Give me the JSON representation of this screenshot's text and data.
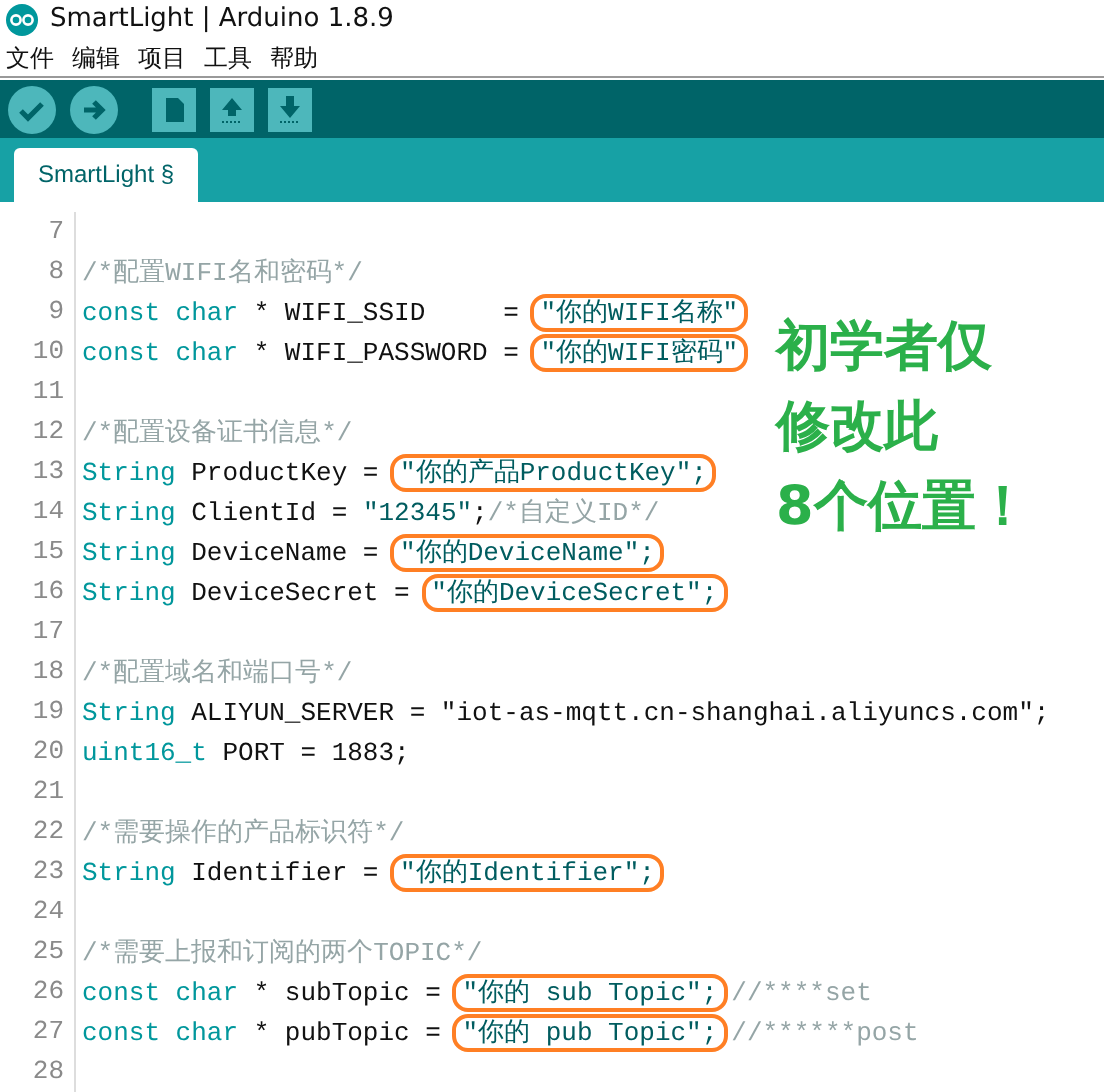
{
  "window": {
    "title": "SmartLight | Arduino 1.8.9"
  },
  "menu": [
    "文件",
    "编辑",
    "项目",
    "工具",
    "帮助"
  ],
  "tabs": [
    {
      "label": "SmartLight §",
      "selected": true
    }
  ],
  "code": [
    {
      "number": "7"
    },
    {
      "number": "8",
      "tokens": [
        {
          "kind": "comment",
          "text": "/*配置WIFI名和密码*/"
        }
      ]
    },
    {
      "number": "9",
      "tokens": [
        {
          "kind": "keyword",
          "text": "const char"
        },
        {
          "kind": "plain",
          "text": " * WIFI_SSID     = "
        },
        {
          "kind": "string",
          "text": "\"你的WIFI名称\"",
          "circled": true
        }
      ]
    },
    {
      "number": "10",
      "tokens": [
        {
          "kind": "keyword",
          "text": "const char"
        },
        {
          "kind": "plain",
          "text": " * WIFI_PASSWORD = "
        },
        {
          "kind": "string",
          "text": "\"你的WIFI密码\"",
          "circled": true
        }
      ]
    },
    {
      "number": "11"
    },
    {
      "number": "12",
      "tokens": [
        {
          "kind": "comment",
          "text": "/*配置设备证书信息*/"
        }
      ]
    },
    {
      "number": "13",
      "tokens": [
        {
          "kind": "keyword",
          "text": "String"
        },
        {
          "kind": "plain",
          "text": " ProductKey = "
        },
        {
          "kind": "string",
          "text": "\"你的产品ProductKey\";",
          "circled": true
        }
      ]
    },
    {
      "number": "14",
      "tokens": [
        {
          "kind": "keyword",
          "text": "String"
        },
        {
          "kind": "plain",
          "text": " ClientId = "
        },
        {
          "kind": "string",
          "text": "\"12345\""
        },
        {
          "kind": "plain",
          "text": ";"
        },
        {
          "kind": "comment",
          "text": "/*自定义ID*/"
        }
      ]
    },
    {
      "number": "15",
      "tokens": [
        {
          "kind": "keyword",
          "text": "String"
        },
        {
          "kind": "plain",
          "text": " DeviceName = "
        },
        {
          "kind": "string",
          "text": "\"你的DeviceName\";",
          "circled": true
        }
      ]
    },
    {
      "number": "16",
      "tokens": [
        {
          "kind": "keyword",
          "text": "String"
        },
        {
          "kind": "plain",
          "text": " DeviceSecret = "
        },
        {
          "kind": "string",
          "text": "\"你的DeviceSecret\";",
          "circled": true
        }
      ]
    },
    {
      "number": "17"
    },
    {
      "number": "18",
      "tokens": [
        {
          "kind": "comment",
          "text": "/*配置域名和端口号*/"
        }
      ]
    },
    {
      "number": "19",
      "tokens": [
        {
          "kind": "keyword",
          "text": "String"
        },
        {
          "kind": "plain",
          "text": " ALIYUN_SERVER = \"iot-as-mqtt.cn-shanghai.aliyuncs.com\";"
        }
      ]
    },
    {
      "number": "20",
      "tokens": [
        {
          "kind": "keyword",
          "text": "uint16_t"
        },
        {
          "kind": "plain",
          "text": " PORT = 1883;"
        }
      ]
    },
    {
      "number": "21"
    },
    {
      "number": "22",
      "tokens": [
        {
          "kind": "comment",
          "text": "/*需要操作的产品标识符*/"
        }
      ]
    },
    {
      "number": "23",
      "tokens": [
        {
          "kind": "keyword",
          "text": "String"
        },
        {
          "kind": "plain",
          "text": " Identifier = "
        },
        {
          "kind": "string",
          "text": "\"你的Identifier\";",
          "circled": true
        }
      ]
    },
    {
      "number": "24"
    },
    {
      "number": "25",
      "tokens": [
        {
          "kind": "comment",
          "text": "/*需要上报和订阅的两个TOPIC*/"
        }
      ]
    },
    {
      "number": "26",
      "tokens": [
        {
          "kind": "keyword",
          "text": "const char"
        },
        {
          "kind": "plain",
          "text": " * subTopic = "
        },
        {
          "kind": "string",
          "text": "\"你的 sub Topic\";",
          "circled": true
        },
        {
          "kind": "comment",
          "text": "//****set"
        }
      ]
    },
    {
      "number": "27",
      "tokens": [
        {
          "kind": "keyword",
          "text": "const char"
        },
        {
          "kind": "plain",
          "text": " * pubTopic = "
        },
        {
          "kind": "string",
          "text": "\"你的 pub Topic\";",
          "circled": true
        },
        {
          "kind": "comment",
          "text": "//******post"
        }
      ]
    },
    {
      "number": "28"
    }
  ],
  "annotation": [
    "初学者仅",
    "修改此",
    "8个位置！"
  ]
}
